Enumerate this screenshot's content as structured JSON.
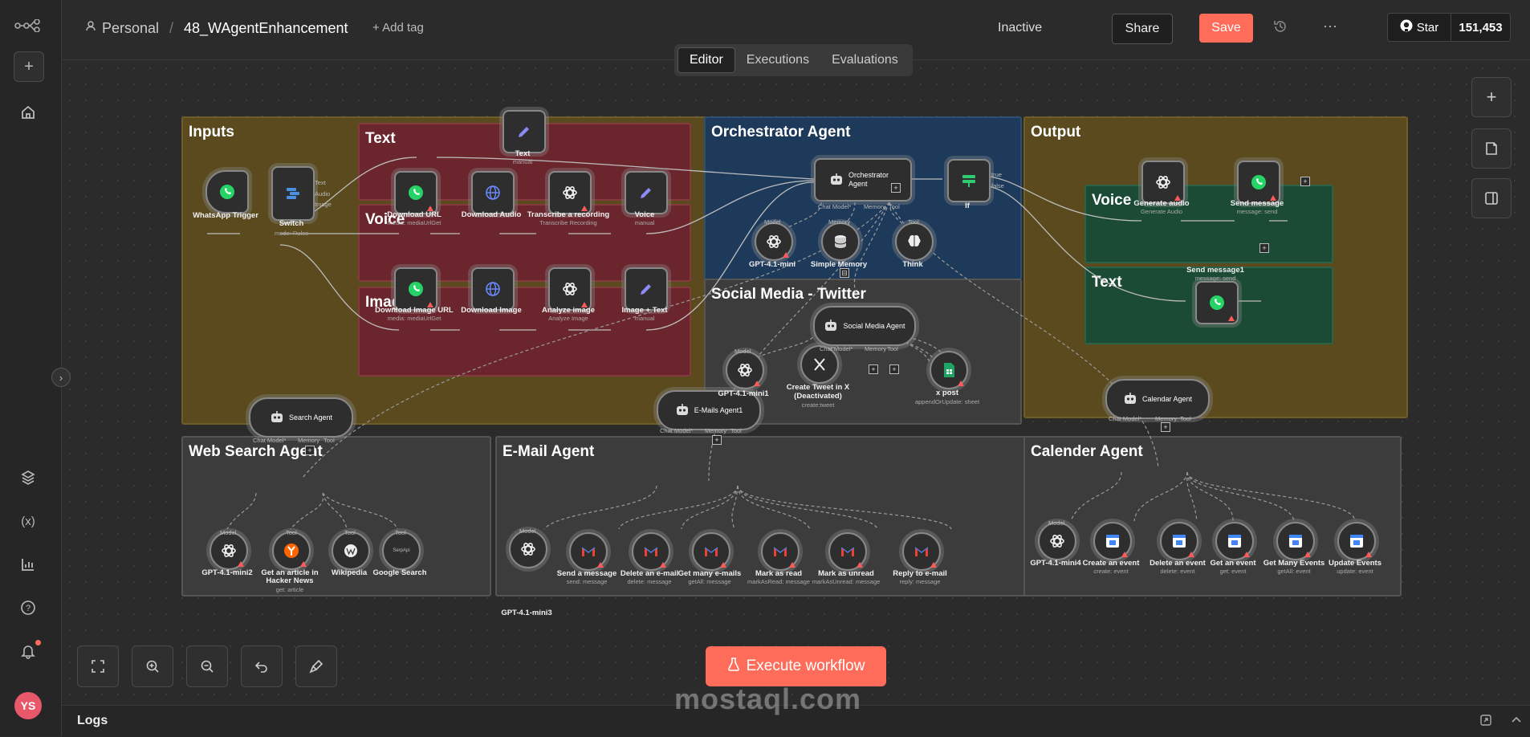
{
  "topbar": {
    "project": "Personal",
    "separator": "/",
    "workflow_name": "48_WAgentEnhancement",
    "add_tag": "+ Add tag",
    "status_label": "Inactive",
    "share_label": "Share",
    "save_label": "Save",
    "more_label": "···",
    "github_star": "Star",
    "github_count": "151,453"
  },
  "tabs": [
    "Editor",
    "Executions",
    "Evaluations"
  ],
  "sidebar": {
    "avatar_initials": "YS"
  },
  "groups": {
    "inputs": "Inputs",
    "text": "Text",
    "voice": "Voice",
    "image": "Image",
    "orchestrator": "Orchestrator Agent",
    "social": "Social Media - Twitter",
    "output": "Output",
    "out_voice": "Voice",
    "out_text": "Text",
    "websearch": "Web Search Agent",
    "email": "E-Mail Agent",
    "calendar": "Calender Agent"
  },
  "nodes": {
    "whatsapp_trigger": {
      "label": "WhatsApp Trigger"
    },
    "switch": {
      "label": "Switch",
      "sub": "mode: Rules",
      "out1": "Text",
      "out2": "Audio",
      "out3": "Image"
    },
    "text": {
      "label": "Text",
      "sub": "manual"
    },
    "download_url": {
      "label": "Download URL",
      "sub": "media: mediaUrlGet"
    },
    "download_audio": {
      "label": "Download Audio"
    },
    "transcribe": {
      "label": "Transcribe a recording",
      "sub": "Transcribe Recording"
    },
    "voice": {
      "label": "Voice",
      "sub": "manual"
    },
    "download_image_url": {
      "label": "Download Image URL",
      "sub": "media: mediaUrlGet"
    },
    "download_image": {
      "label": "Download Image"
    },
    "analyze_image": {
      "label": "Analyze image",
      "sub": "Analyze Image"
    },
    "image_text": {
      "label": "Image + Text",
      "sub": "manual"
    },
    "orchestrator": {
      "label": "Orchestrator Agent",
      "chat": "Chat Model*",
      "memory": "Memory",
      "tool": "Tool"
    },
    "if": {
      "label": "If",
      "true": "true",
      "false": "false"
    },
    "gpt_main": {
      "label": "GPT-4.1-mini",
      "port": "Model"
    },
    "simple_memory": {
      "label": "Simple Memory",
      "port": "Memory"
    },
    "think": {
      "label": "Think",
      "port": "Tool"
    },
    "social_agent": {
      "label": "Social Media Agent",
      "chat": "Chat Model*",
      "memory": "Memory",
      "tool": "Tool"
    },
    "gpt1": {
      "label": "GPT-4.1-mini1",
      "port": "Model"
    },
    "tweet": {
      "label": "Create Tweet in X (Deactivated)",
      "label1": "Create Tweet in X",
      "label2": "(Deactivated)",
      "sub": "create:tweet"
    },
    "xpost": {
      "label": "x post",
      "sub": "appendOrUpdate: sheet"
    },
    "generate_audio": {
      "label": "Generate audio",
      "sub": "Generate Audio"
    },
    "send_message": {
      "label": "Send message",
      "sub": "message: send"
    },
    "send_message1": {
      "label": "Send message1",
      "sub": "message: send"
    },
    "search_agent": {
      "label": "Search Agent",
      "chat": "Chat Model*",
      "memory": "Memory",
      "tool": "Tool"
    },
    "gpt2": {
      "label": "GPT-4.1-mini2",
      "port": "Model"
    },
    "hacker_news": {
      "label": "Get an article in Hacker News",
      "label1": "Get an article in",
      "label2": "Hacker News",
      "sub": "get: article",
      "port": "Tool"
    },
    "wikipedia": {
      "label": "Wikipedia",
      "port": "Tool"
    },
    "google_search": {
      "label": "Google Search",
      "port": "Tool",
      "inner": "SerpApi"
    },
    "email_agent": {
      "label": "E-Mails Agent1",
      "chat": "Chat Model*",
      "memory": "Memory",
      "tool": "Tool"
    },
    "gpt3": {
      "label": "GPT-4.1-mini3",
      "port": "Model"
    },
    "send_email": {
      "label": "Send a message",
      "sub": "send: message"
    },
    "delete_email": {
      "label": "Delete an e-mail",
      "sub": "delete: message"
    },
    "get_many_emails": {
      "label": "Get many e-mails",
      "sub": "getAll: message"
    },
    "mark_read": {
      "label": "Mark as read",
      "sub": "markAsRead: message"
    },
    "mark_unread": {
      "label": "Mark as unread",
      "sub": "markAsUnread: message"
    },
    "reply_email": {
      "label": "Reply to e-mail",
      "sub": "reply: message"
    },
    "calendar_agent": {
      "label": "Calendar Agent",
      "chat": "Chat Model*",
      "memory": "Memory",
      "tool": "Tool"
    },
    "gpt4": {
      "label": "GPT-4.1-mini4",
      "port": "Model"
    },
    "create_event": {
      "label": "Create an event",
      "sub": "create: event"
    },
    "delete_event": {
      "label": "Delete an event",
      "sub": "delete: event"
    },
    "get_event": {
      "label": "Get an event",
      "sub": "get: event"
    },
    "get_many_events": {
      "label": "Get Many Events",
      "sub": "getAll: event"
    },
    "update_events": {
      "label": "Update Events",
      "sub": "update: event"
    }
  },
  "bottom": {
    "execute_label": "Execute workflow",
    "logs_label": "Logs",
    "watermark": "mostaql.com"
  },
  "colors": {
    "accent": "#ff6d5a",
    "inputs_group": "#5a4a1e",
    "red_group": "#6b262d",
    "blue_group": "#1e3a5a",
    "green_group": "#1b4a35",
    "gray_group": "#3c3c3c",
    "whatsapp": "#25d366",
    "gmail": "#ea4335",
    "calendar": "#4285f4",
    "edit": "#8b8bf5"
  },
  "icons": {
    "logo": "n8n-logo-icon",
    "whatsapp": "whatsapp-icon",
    "switch": "switch-icon",
    "pencil": "pencil-icon",
    "globe": "globe-icon",
    "openai": "openai-icon",
    "robot": "robot-icon",
    "if": "if-icon",
    "database": "database-icon",
    "brain": "brain-icon",
    "x": "x-icon",
    "sheet": "sheet-icon",
    "gmail": "gmail-icon",
    "calendar": "calendar-icon"
  }
}
